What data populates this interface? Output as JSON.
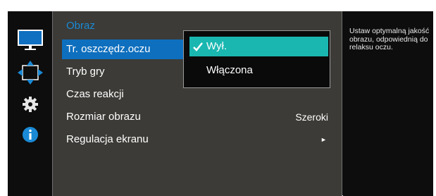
{
  "menu": {
    "title": "Obraz",
    "items": [
      {
        "label": "Tr. oszczędz.oczu",
        "selected": true
      },
      {
        "label": "Tryb gry"
      },
      {
        "label": "Czas reakcji"
      },
      {
        "label": "Rozmiar obrazu",
        "value": "Szeroki"
      },
      {
        "label": "Regulacja ekranu",
        "arrow": "►"
      }
    ]
  },
  "submenu": {
    "options": [
      {
        "label": "Wył.",
        "selected": true,
        "icon": "check-icon"
      },
      {
        "label": "Włączona"
      }
    ]
  },
  "help": {
    "text": "Ustaw optymalną jakość obrazu, odpowiednią do relaksu oczu."
  },
  "sidebar_icons": [
    "monitor-icon",
    "move-arrows-icon",
    "gear-icon",
    "info-icon"
  ],
  "colors": {
    "title": "#1a8ad6",
    "menu_highlight": "#0e6fbe",
    "submenu_highlight": "#1ab7b1",
    "panel_bg": "#3c3b37",
    "osd_bg": "#0d0d0d"
  }
}
